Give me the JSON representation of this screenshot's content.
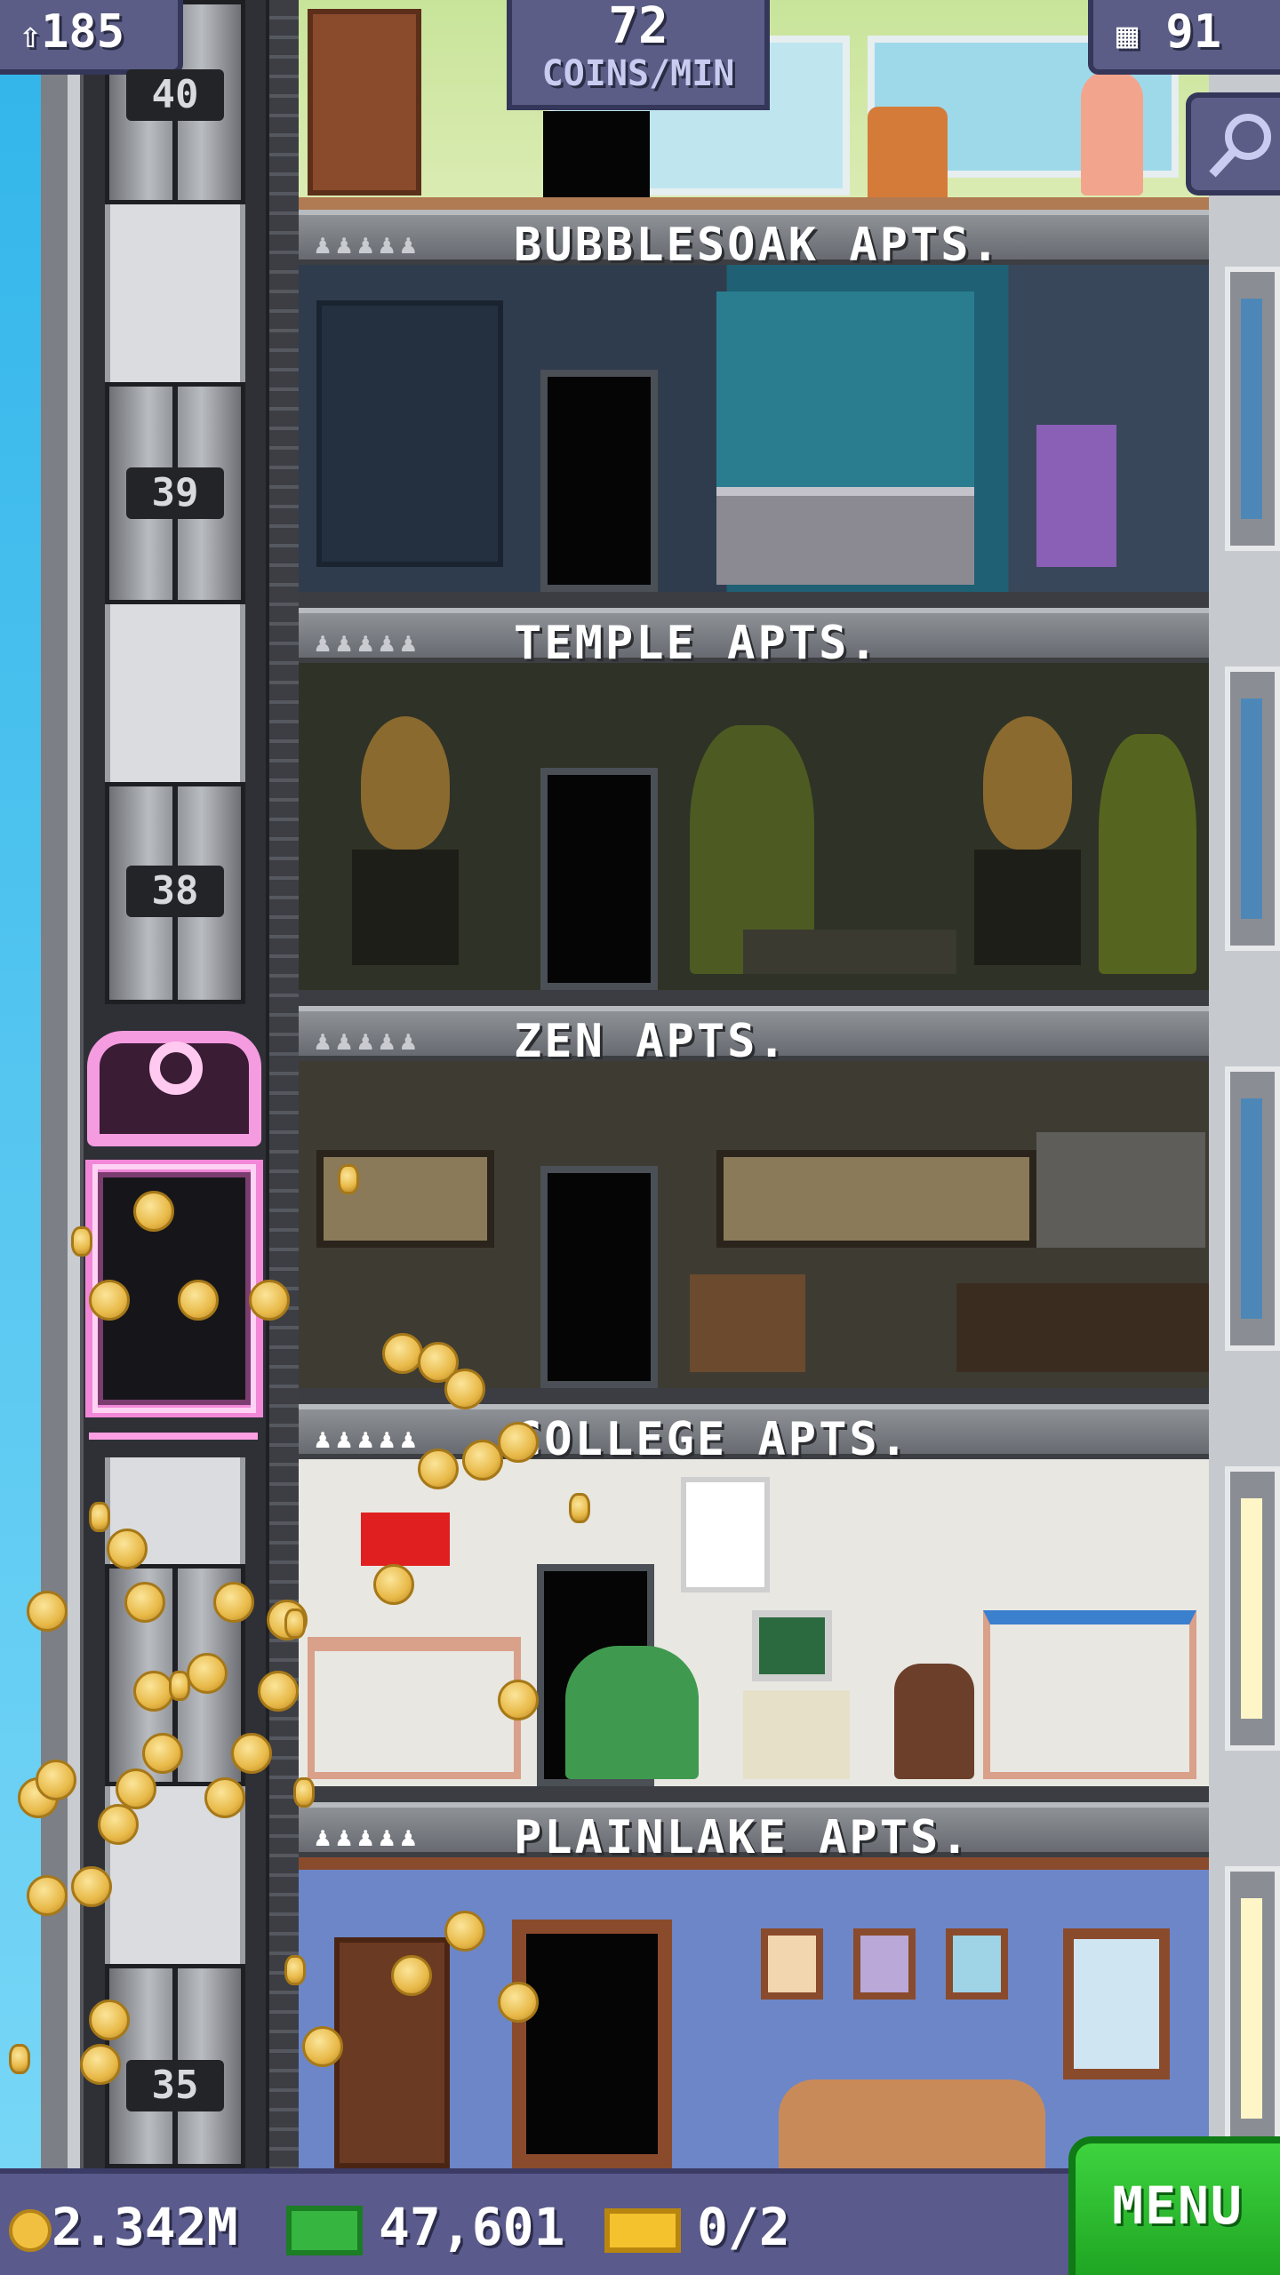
{
  "top_bar": {
    "population": "185",
    "coins_per_min_value": "72",
    "coins_per_min_label": "COINS/MIN",
    "floors_count": "91"
  },
  "elevator": {
    "floor_numbers": [
      "40",
      "39",
      "38",
      "35"
    ]
  },
  "floors": [
    {
      "name": "BUBBLESOAK APTS.",
      "residents_icons": "♟♟♟♟♟"
    },
    {
      "name": "TEMPLE APTS.",
      "residents_icons": "♟♟♟♟♟"
    },
    {
      "name": "ZEN APTS.",
      "residents_icons": "♟♟♟♟♟"
    },
    {
      "name": "COLLEGE APTS.",
      "residents_icons": "♟♟♟♟♟"
    },
    {
      "name": "PLAINLAKE APTS.",
      "residents_icons": "♟♟♟♟♟"
    }
  ],
  "bottom_bar": {
    "coins": "2.342M",
    "bux": "47,601",
    "tickets": "0/2",
    "menu_label": "MENU"
  },
  "colors": {
    "menu_green": "#2fbf33",
    "bar_purple": "#5b5d86",
    "coin_gold": "#e8b948",
    "elevator_pink": "#f287d8"
  },
  "icons": {
    "population": "person-up-icon",
    "floors": "building-icon",
    "search": "magnifier-icon",
    "coin": "coin-icon",
    "bux": "banknote-icon",
    "ticket": "golden-ticket-icon"
  }
}
